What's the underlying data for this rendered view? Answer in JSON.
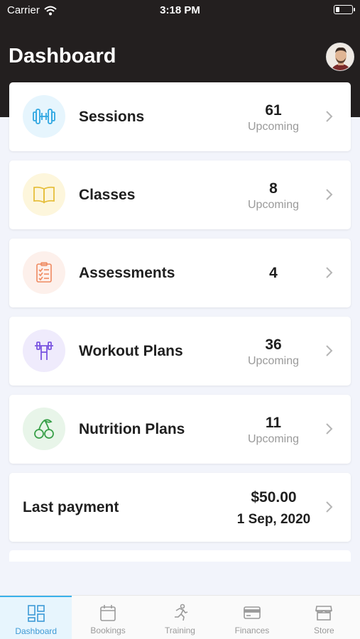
{
  "status_bar": {
    "carrier": "Carrier",
    "time": "3:18 PM"
  },
  "header": {
    "title": "Dashboard"
  },
  "cards": [
    {
      "label": "Sessions",
      "count": "61",
      "sub": "Upcoming",
      "icon": "dumbbell-icon",
      "color": "#2fa7e1",
      "bg": "#e6f5fd"
    },
    {
      "label": "Classes",
      "count": "8",
      "sub": "Upcoming",
      "icon": "book-icon",
      "color": "#e6bf3c",
      "bg": "#fdf6dc"
    },
    {
      "label": "Assessments",
      "count": "4",
      "sub": "",
      "icon": "checklist-icon",
      "color": "#ef8a61",
      "bg": "#fdf0eb"
    },
    {
      "label": "Workout Plans",
      "count": "36",
      "sub": "Upcoming",
      "icon": "barbell-icon",
      "color": "#7a55e0",
      "bg": "#efebfc"
    },
    {
      "label": "Nutrition Plans",
      "count": "11",
      "sub": "Upcoming",
      "icon": "cherries-icon",
      "color": "#3aa04a",
      "bg": "#e8f5e9"
    }
  ],
  "payment": {
    "label": "Last payment",
    "amount": "$50.00",
    "date": "1 Sep, 2020"
  },
  "tabs": [
    {
      "label": "Dashboard",
      "icon": "dashboard-icon",
      "active": true
    },
    {
      "label": "Bookings",
      "icon": "calendar-icon",
      "active": false
    },
    {
      "label": "Training",
      "icon": "runner-icon",
      "active": false
    },
    {
      "label": "Finances",
      "icon": "card-icon",
      "active": false
    },
    {
      "label": "Store",
      "icon": "store-icon",
      "active": false
    }
  ]
}
